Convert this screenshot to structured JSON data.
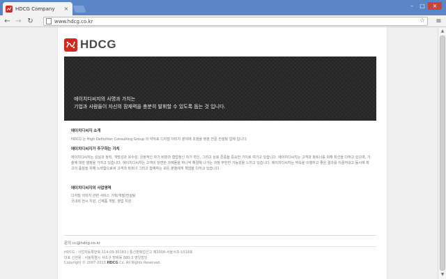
{
  "browser": {
    "tab_title": "HDCG Company",
    "tab_close": "×",
    "url": "www.hdcg.co.kr",
    "icons": {
      "back": "back-arrow-icon",
      "forward": "forward-arrow-icon",
      "reload": "reload-icon",
      "star": "star-icon",
      "menu": "menu-icon"
    },
    "glyphs": {
      "back": "←",
      "forward": "→",
      "reload": "↻",
      "star": "☆",
      "menu": "≡",
      "minimize": "–",
      "maximize": "□",
      "close": "×"
    }
  },
  "page": {
    "logo_text": "HDCG",
    "banner": {
      "line1": "에이치디씨지의 사명과 가치는",
      "line2": "기업과 사람들이 자신의 잠재력을 충분히 발휘할 수 있도록 돕는 것 입니다."
    },
    "sections": {
      "about": {
        "title": "에이치디씨지 소개",
        "body": "HDCG 는 High Definition Consulting Group 의 약자로 디지털 이미지 분야에 초점을 맞춘 전문 컨설팅 업체 입니다."
      },
      "values": {
        "title": "에이치디씨지가 추구하는 가치",
        "body": "에이치디씨지는 성실과 정직, 개방성과 유수성, 긍정적인 자기 비판과 협업정신 자기 혁신, 그리고 상호 존중을 중요한 가치로 여기고 있습니다. 에이치디씨지는 고객과 파트너를 위해 최선을 다하고 있으며, 기술에 대한 열정을 가지고 있습니다. 에이치디씨지는 고객이 당면한 과제들을 하나씩 해결해 나가는 과정 무한한 가능성을 느끼고 있습니다. 에이치디씨지는 약속을 이행하고 좋은 결과를 이끌어내고 동시에 최고의 품질을 위해 노력함으로써 고객과 파트너 그리고 함께하는 모든 분들에게 책임을 다하고 있습니다."
      },
      "business": {
        "title": "에이치디씨지의 사업영역",
        "items": [
          "디지털 이미지 관련 서비스 기획/개발/컨설팅",
          "국내외 전시 지원, 신제품 개발, 영업 지원"
        ]
      }
    },
    "footer": {
      "email": "문의 cc@hdcg.co.kr",
      "line1": "HDCG : 사업자등록번호:114-09-30183 | 통신판매업신고 제2008-서울서초-1019호",
      "line2": "대표 신현용 : 서울특별시 서초구 방배동 880-3 영일빌딩",
      "line3_pre": "Copyright © 2007-2013 ",
      "line3_brand": "HDCG",
      "line3_post": " Co. All Rights Reserved."
    }
  },
  "colors": {
    "tabstrip": "#5a86c8",
    "brand_red": "#d9261c",
    "banner_bg": "#262626"
  }
}
